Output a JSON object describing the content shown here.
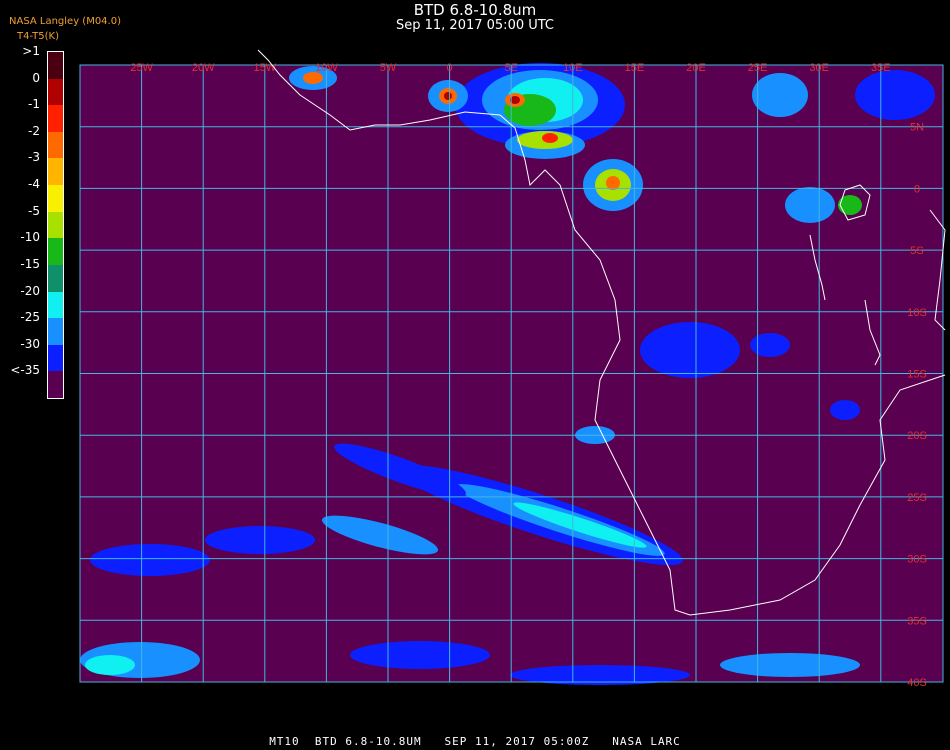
{
  "header": {
    "title": "BTD 6.8-10.8um",
    "subtitle": "Sep 11, 2017 05:00 UTC",
    "agency": "NASA Langley (M04.0)",
    "unit": "T4-T5(K)"
  },
  "legend": {
    "entries": [
      {
        "label": ">1",
        "color": "#4a0010"
      },
      {
        "label": "0",
        "color": "#b00000"
      },
      {
        "label": "-1",
        "color": "#ff2000"
      },
      {
        "label": "-2",
        "color": "#ff6a00"
      },
      {
        "label": "-3",
        "color": "#ffb400"
      },
      {
        "label": "-4",
        "color": "#f8f000"
      },
      {
        "label": "-5",
        "color": "#a8e000"
      },
      {
        "label": "-10",
        "color": "#18b818"
      },
      {
        "label": "-15",
        "color": "#10906a"
      },
      {
        "label": "-20",
        "color": "#10f0f0"
      },
      {
        "label": "-25",
        "color": "#1890ff"
      },
      {
        "label": "-30",
        "color": "#0c20ff"
      },
      {
        "label": "<-35",
        "color": "#5a0050"
      }
    ]
  },
  "map": {
    "background": "#5a0050",
    "grid_color": "#40b8e0",
    "label_color": "#e03030",
    "coast_color": "#ffffff",
    "lon_labels": [
      "25W",
      "20W",
      "15W",
      "10W",
      "5W",
      "0",
      "5E",
      "10E",
      "15E",
      "20E",
      "25E",
      "30E",
      "35E"
    ],
    "lat_labels": [
      "5N",
      "0",
      "5S",
      "10S",
      "15S",
      "20S",
      "25S",
      "30S",
      "35S",
      "40S"
    ]
  },
  "footer": {
    "text": "MT10  BTD 6.8-10.8UM   SEP 11, 2017 05:00Z   NASA LARC"
  }
}
